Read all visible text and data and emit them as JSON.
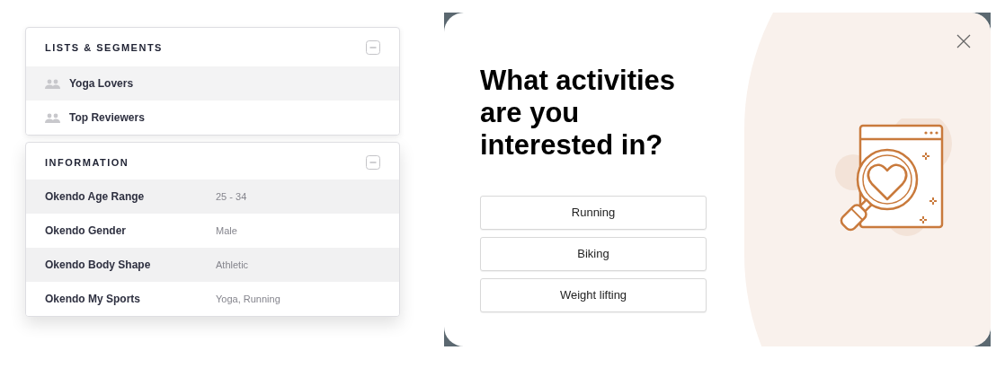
{
  "lists_card": {
    "title": "LISTS & SEGMENTS",
    "items": [
      {
        "label": "Yoga Lovers",
        "highlighted": true
      },
      {
        "label": "Top Reviewers",
        "highlighted": false
      }
    ]
  },
  "info_card": {
    "title": "INFORMATION",
    "rows": [
      {
        "label": "Okendo Age Range",
        "value": "25 - 34",
        "highlighted": true
      },
      {
        "label": "Okendo Gender",
        "value": "Male",
        "highlighted": false
      },
      {
        "label": "Okendo Body Shape",
        "value": "Athletic",
        "highlighted": true
      },
      {
        "label": "Okendo My Sports",
        "value": "Yoga, Running",
        "highlighted": false
      }
    ]
  },
  "modal": {
    "question": "What activities are you interested in?",
    "options": [
      "Running",
      "Biking",
      "Weight lifting"
    ]
  }
}
